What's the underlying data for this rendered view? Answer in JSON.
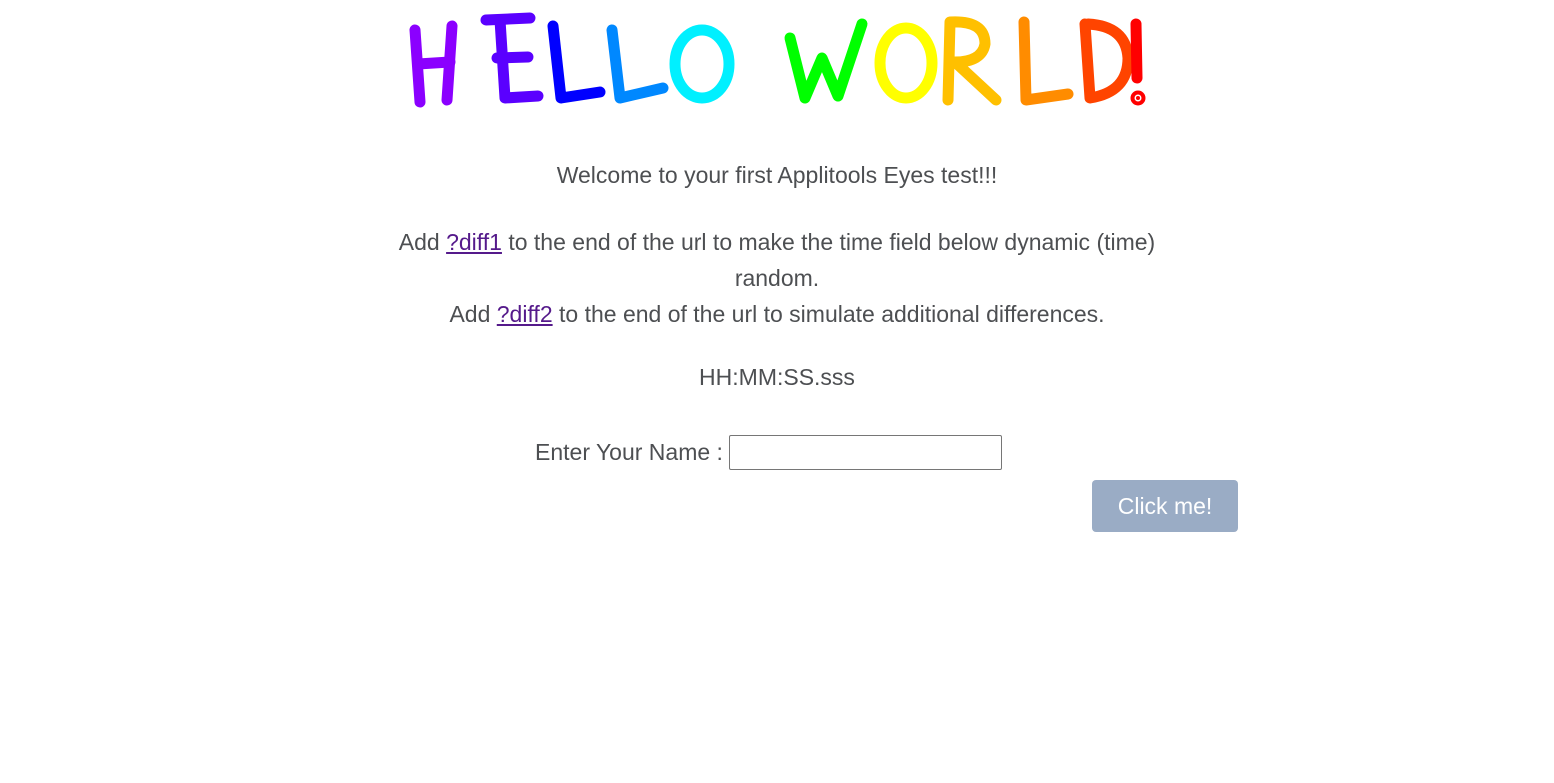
{
  "header": {
    "title_image_text": "HELLO WORLD!"
  },
  "welcome": {
    "text": "Welcome to your first Applitools Eyes test!!!"
  },
  "instructions": {
    "line1_prefix": "Add ",
    "diff1_link": "?diff1",
    "line1_suffix": " to the end of the url to make the time field below dynamic (time) random.",
    "line2_prefix": "Add ",
    "diff2_link": "?diff2",
    "line2_suffix": " to the end of the url to simulate additional differences."
  },
  "time_field": {
    "value": "HH:MM:SS.sss"
  },
  "form": {
    "name_label": "Enter Your Name :",
    "name_value": "",
    "button_label": "Click me!"
  },
  "colors": {
    "text": "#4d4f52",
    "link": "#551a8b",
    "button_bg": "#9aacc5",
    "button_text": "#ffffff",
    "rainbow": [
      "#8b00ff",
      "#6a00ff",
      "#0000ff",
      "#0080ff",
      "#00ffff",
      "#00ff00",
      "#80ff00",
      "#ffff00",
      "#ffc000",
      "#ff8000",
      "#ff4000",
      "#ff0000"
    ]
  }
}
